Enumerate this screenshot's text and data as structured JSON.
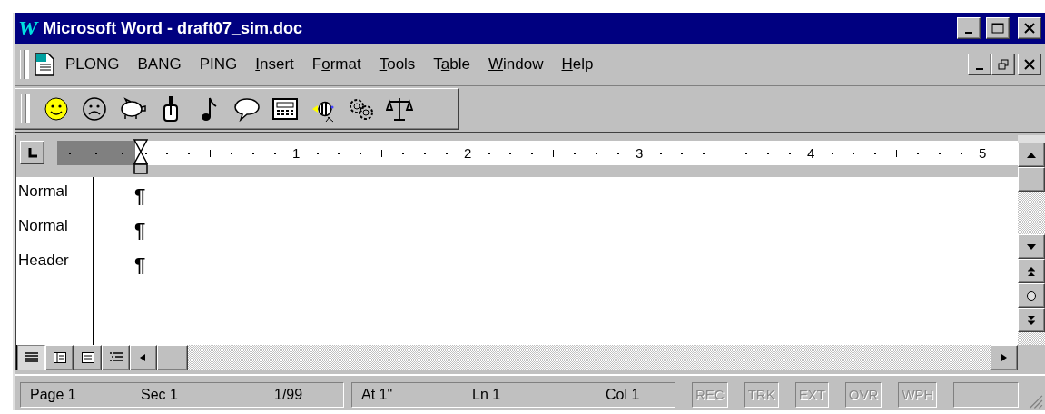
{
  "window": {
    "logo": "W",
    "title": "Microsoft Word - draft07_sim.doc"
  },
  "menu": [
    {
      "pre": "PLONG"
    },
    {
      "pre": "BANG"
    },
    {
      "pre": "PING"
    },
    {
      "key": "I",
      "post": "nsert"
    },
    {
      "pre": "F",
      "key": "o",
      "post": "rmat"
    },
    {
      "key": "T",
      "post": "ools"
    },
    {
      "pre": "T",
      "key": "a",
      "post": "ble"
    },
    {
      "key": "W",
      "post": "indow"
    },
    {
      "key": "H",
      "post": "elp"
    }
  ],
  "ruler": {
    "numbers": [
      "1",
      "2",
      "3",
      "4",
      "5"
    ]
  },
  "document": {
    "paragraphs": [
      {
        "style": "Normal",
        "mark": "¶"
      },
      {
        "style": "Normal",
        "mark": "¶"
      },
      {
        "style": "Header",
        "mark": "¶"
      }
    ]
  },
  "view_buttons": [
    {
      "kind": "normal",
      "selected": true
    },
    {
      "kind": "online",
      "selected": false
    },
    {
      "kind": "page",
      "selected": false
    },
    {
      "kind": "outline",
      "selected": false
    }
  ],
  "status_bar": {
    "sections": [
      [
        "Page 1",
        "Sec 1",
        "1/99"
      ],
      [
        "At 1\"",
        "Ln 1",
        "Col 1"
      ]
    ],
    "indicators": [
      {
        "label": "REC",
        "disabled": true
      },
      {
        "label": "TRK",
        "disabled": true
      },
      {
        "label": "EXT",
        "disabled": true
      },
      {
        "label": "OVR",
        "disabled": true
      },
      {
        "label": "WPH",
        "disabled": true
      }
    ]
  }
}
